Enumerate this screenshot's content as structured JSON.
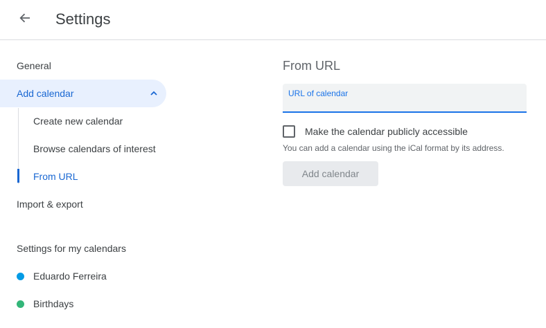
{
  "header": {
    "title": "Settings",
    "back_icon": "arrow-back-icon"
  },
  "sidebar": {
    "general": "General",
    "add_calendar": "Add calendar",
    "sub_items": [
      "Create new calendar",
      "Browse calendars of interest",
      "From URL"
    ],
    "import_export": "Import & export",
    "section_title": "Settings for my calendars",
    "calendars": [
      {
        "name": "Eduardo Ferreira",
        "color": "#039be5"
      },
      {
        "name": "Birthdays",
        "color": "#33b679"
      }
    ]
  },
  "main": {
    "title": "From URL",
    "url_label": "URL of calendar",
    "url_value": "",
    "public_checkbox_label": "Make the calendar publicly accessible",
    "public_checked": false,
    "help_text": "You can add a calendar using the iCal format by its address.",
    "add_button": "Add calendar"
  },
  "colors": {
    "accent": "#1967d2",
    "active_bg": "#e8f0fe"
  }
}
